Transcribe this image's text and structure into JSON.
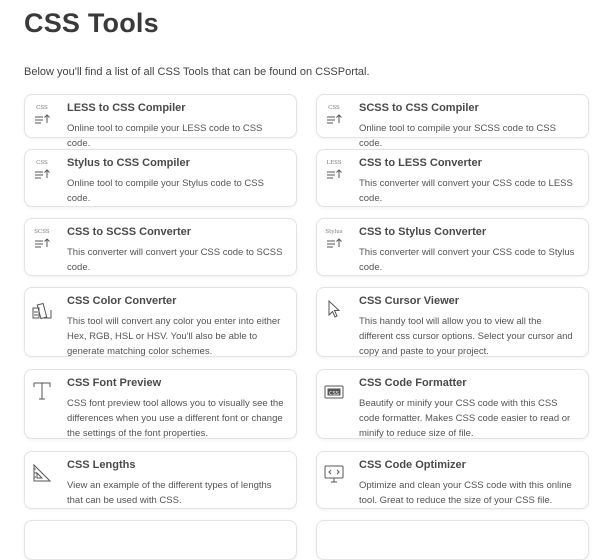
{
  "page": {
    "title": "CSS Tools",
    "intro": "Below you'll find a list of all CSS Tools that can be found on CSSPortal."
  },
  "tools": [
    {
      "name": "LESS to CSS Compiler",
      "desc": "Online tool to compile your LESS code to CSS code.",
      "icon": "css-compile-icon",
      "icon_label": "CSS"
    },
    {
      "name": "SCSS to CSS Compiler",
      "desc": "Online tool to compile your SCSS code to CSS code.",
      "icon": "css-compile-icon",
      "icon_label": "CSS"
    },
    {
      "name": "Stylus to CSS Compiler",
      "desc": "Online tool to compile your Stylus code to CSS code.",
      "icon": "css-compile-icon",
      "icon_label": "CSS"
    },
    {
      "name": "CSS to LESS Converter",
      "desc": "This converter will convert your CSS code to LESS code.",
      "icon": "less-convert-icon",
      "icon_label": "LESS"
    },
    {
      "name": "CSS to SCSS Converter",
      "desc": "This converter will convert your CSS code to SCSS code.",
      "icon": "scss-convert-icon",
      "icon_label": "SCSS"
    },
    {
      "name": "CSS to Stylus Converter",
      "desc": "This converter will convert your CSS code to Stylus code.",
      "icon": "stylus-convert-icon",
      "icon_label": "Stylus"
    },
    {
      "name": "CSS Color Converter",
      "desc": "This tool will convert any color you enter into either Hex, RGB, HSL or HSV. You'll also be able to generate matching color schemes.",
      "icon": "color-swatch-icon"
    },
    {
      "name": "CSS Cursor Viewer",
      "desc": "This handy tool will allow you to view all the different css cursor options. Select your cursor and copy and paste to your project.",
      "icon": "cursor-icon"
    },
    {
      "name": "CSS Font Preview",
      "desc": "CSS font preview tool allows you to visually see the differences when you use a different font or change the settings of the font properties.",
      "icon": "font-icon"
    },
    {
      "name": "CSS Code Formatter",
      "desc": "Beautify or minify your CSS code with this CSS code formatter. Makes CSS code easier to read or minify to reduce size of file.",
      "icon": "code-format-icon",
      "icon_label": "CSS"
    },
    {
      "name": "CSS Lengths",
      "desc": "View an example of the different types of lengths that can be used with CSS.",
      "icon": "ruler-icon"
    },
    {
      "name": "CSS Code Optimizer",
      "desc": "Optimize and clean your CSS code with this online tool. Great to reduce the size of your CSS file.",
      "icon": "monitor-code-icon"
    }
  ]
}
